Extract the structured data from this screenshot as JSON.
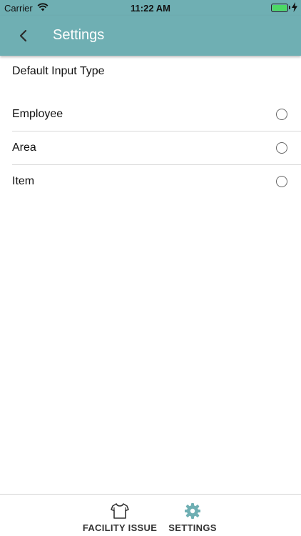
{
  "status_bar": {
    "carrier": "Carrier",
    "time": "11:22 AM",
    "battery_level": 1.0
  },
  "nav": {
    "title": "Settings",
    "background": "#6fafb3"
  },
  "section": {
    "header": "Default Input Type"
  },
  "options": [
    {
      "label": "Employee",
      "selected": false
    },
    {
      "label": "Area",
      "selected": false
    },
    {
      "label": "Item",
      "selected": false
    }
  ],
  "tabs": [
    {
      "label": "FACILITY ISSUE",
      "icon": "shirt-icon"
    },
    {
      "label": "SETTINGS",
      "icon": "gear-icon",
      "active": true,
      "active_color": "#6fafb3"
    }
  ]
}
